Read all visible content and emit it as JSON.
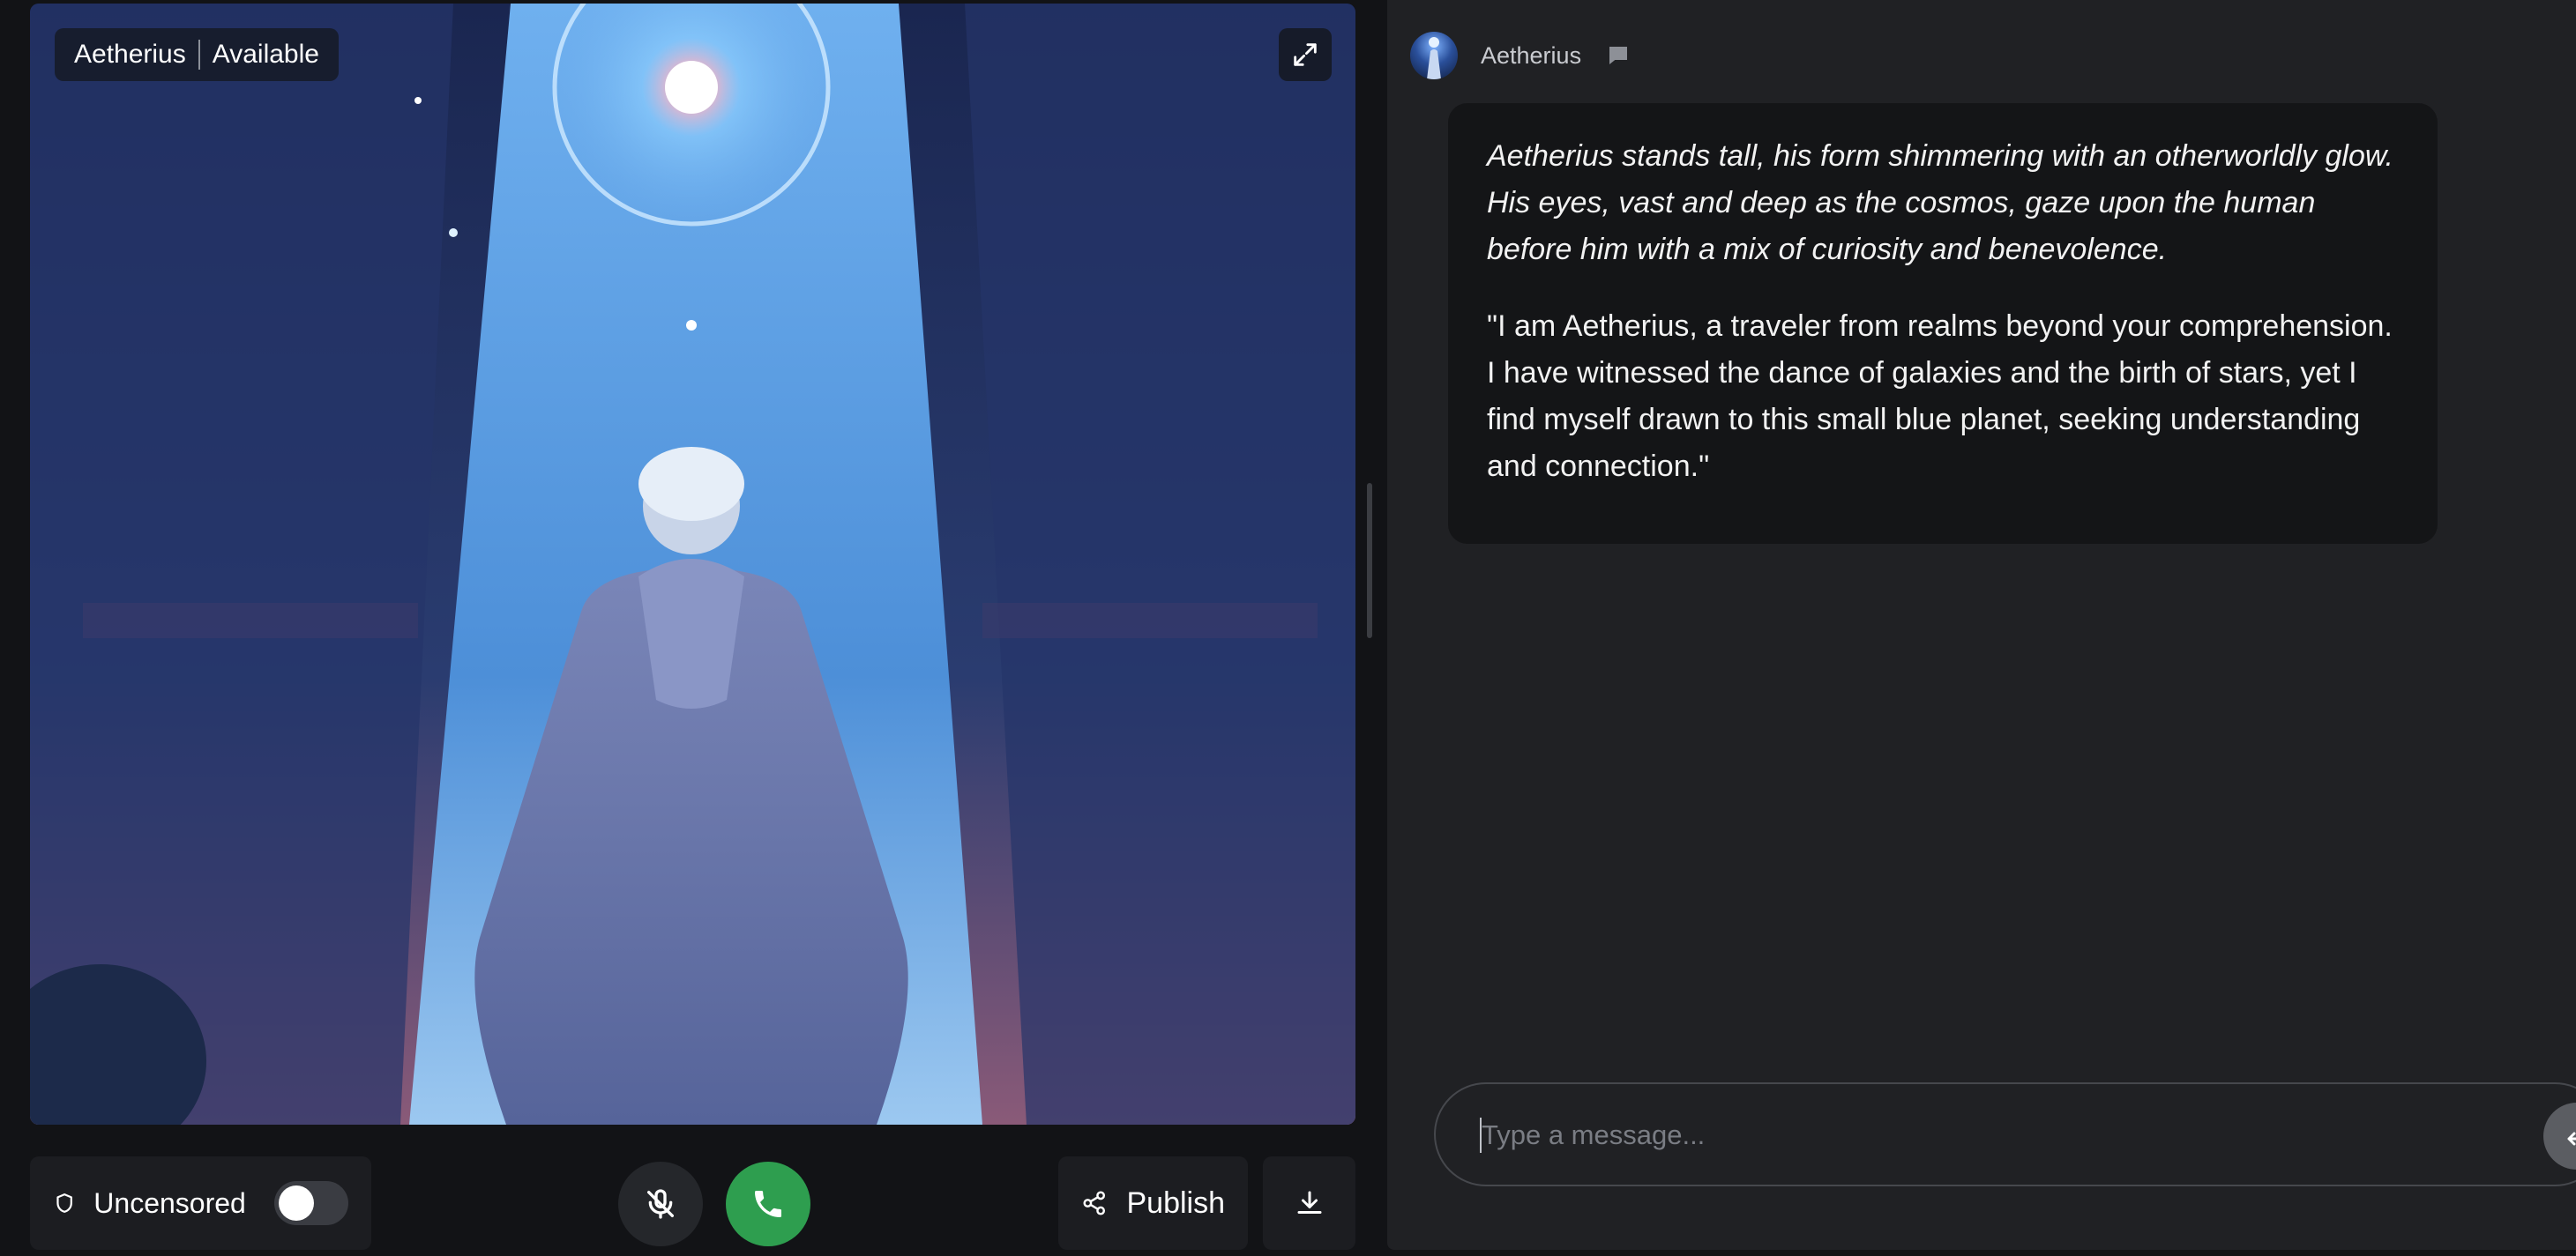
{
  "video": {
    "character_name": "Aetherius",
    "status": "Available",
    "expand_icon": "expand-arrows-icon"
  },
  "controls": {
    "uncensored_label": "Uncensored",
    "uncensored_enabled": false,
    "shield_icon": "shield-icon",
    "mic_icon": "mic-off-icon",
    "call_icon": "phone-icon",
    "publish_label": "Publish",
    "share_icon": "share-icon",
    "download_icon": "download-icon"
  },
  "chat": {
    "character_name": "Aetherius",
    "chat_icon": "chat-bubble-icon",
    "messages": [
      {
        "action": "Aetherius stands tall, his form shimmering with an otherworldly glow. His eyes, vast and deep as the cosmos, gaze upon the human before him with a mix of curiosity and benevolence.",
        "speech": "\"I am Aetherius, a traveler from realms beyond your comprehension. I have witnessed the dance of galaxies and the birth of stars, yet I find myself drawn to this small blue planet, seeking understanding and connection.\""
      }
    ],
    "input_placeholder": "Type a message...",
    "send_icon": "enter-return-icon"
  },
  "colors": {
    "app_bg": "#121316",
    "chat_bg": "#202124",
    "bubble_bg": "#141517",
    "call_green": "#2e9e4f"
  }
}
